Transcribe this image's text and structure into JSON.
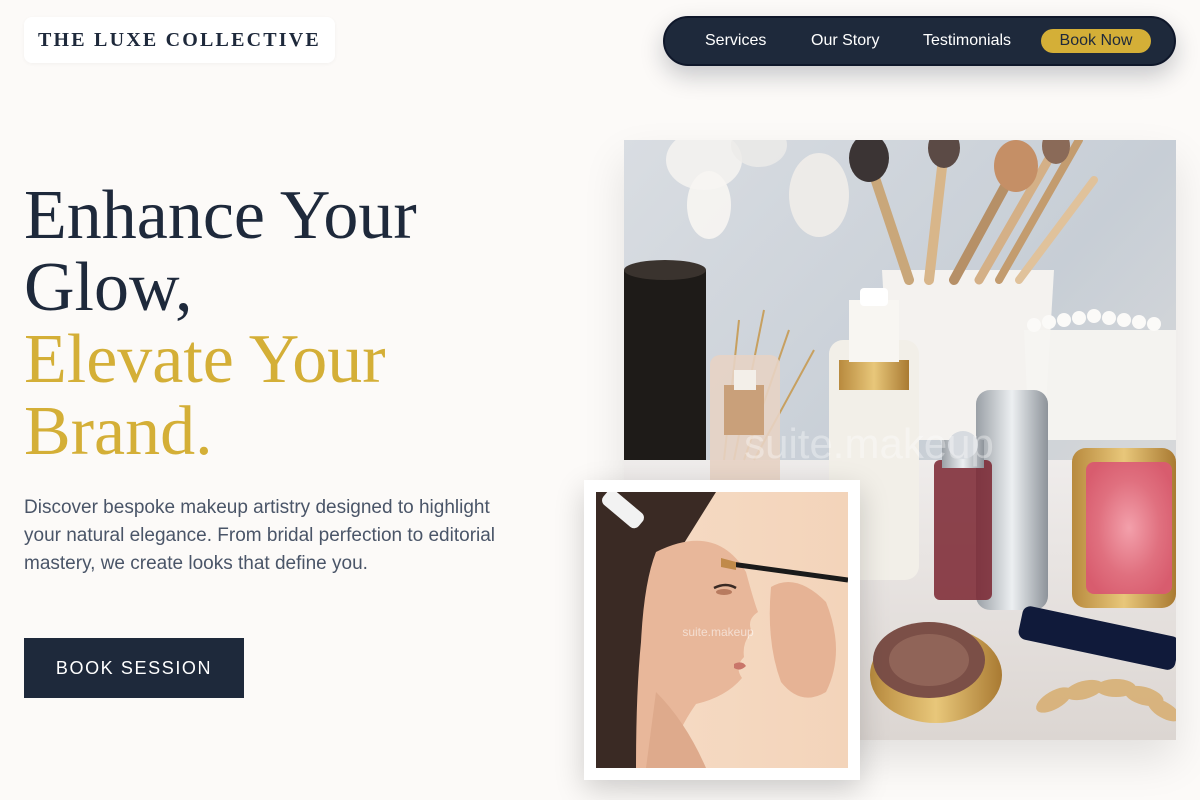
{
  "brand": {
    "name": "THE LUXE COLLECTIVE"
  },
  "nav": {
    "items": [
      {
        "label": "Services"
      },
      {
        "label": "Our Story"
      },
      {
        "label": "Testimonials"
      }
    ],
    "cta_label": "Book Now"
  },
  "hero": {
    "title_line1": "Enhance Your",
    "title_line2": "Glow,",
    "title_line3": "Elevate Your",
    "title_line4": "Brand.",
    "description": "Discover bespoke makeup artistry designed to highlight your natural elegance. From bridal perfection to editorial mastery, we create looks that define you.",
    "button_label": "BOOK SESSION"
  },
  "images": {
    "main_watermark": "suite.makeup",
    "inset_watermark": "suite.makeup"
  },
  "colors": {
    "navy": "#1e293b",
    "gold": "#d4af37",
    "background": "#fcfaf8",
    "body_text": "#4a5568"
  }
}
